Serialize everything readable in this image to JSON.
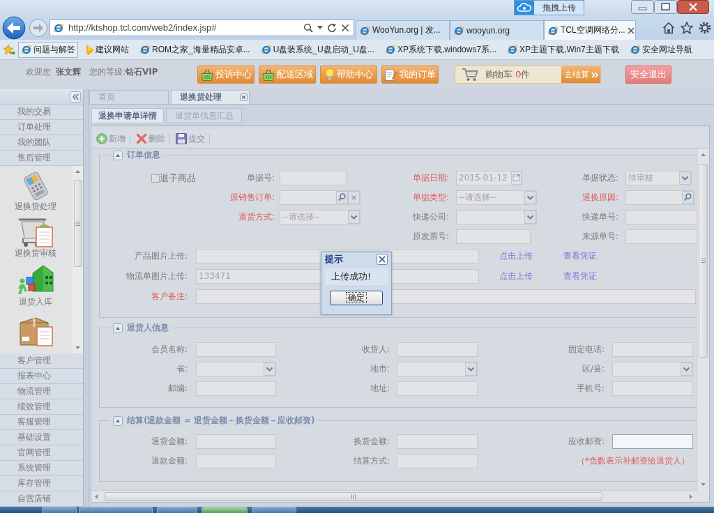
{
  "browser": {
    "upload_button": "拖拽上传",
    "address": "http://ktshop.tcl.com/web2/index.jsp#",
    "tabs": [
      {
        "label": "WooYun.org | 发...",
        "selected": false
      },
      {
        "label": "wooyun.org",
        "selected": false
      },
      {
        "label": "TCL空调网络分...",
        "selected": true
      }
    ],
    "favorites": [
      {
        "label": "问题与解答",
        "kind": "web",
        "hovered": true
      },
      {
        "label": "建议网站",
        "kind": "suggest",
        "hovered": false
      },
      {
        "label": "ROM之家_海量精品安卓...",
        "kind": "web",
        "hovered": false
      },
      {
        "label": "U盘装系统_U盘启动_U盘...",
        "kind": "web",
        "hovered": false
      },
      {
        "label": "XP系统下载,windows7系...",
        "kind": "web",
        "hovered": false
      },
      {
        "label": "XP主题下载,Win7主题下载",
        "kind": "web",
        "hovered": false
      },
      {
        "label": "安全网址导航",
        "kind": "web",
        "hovered": false
      }
    ]
  },
  "header": {
    "welcome": "欢迎您",
    "user": "张文辉",
    "level_label": "您的等级:",
    "level": "钻石VIP",
    "buttons": [
      {
        "label": "投诉中心",
        "kind": "basket"
      },
      {
        "label": "配送区域",
        "kind": "basket"
      },
      {
        "label": "帮助中心",
        "kind": "bulb"
      },
      {
        "label": "我的订单",
        "kind": "notes"
      }
    ],
    "cart": {
      "label": "购物车",
      "count": "0",
      "unit": "件",
      "checkout": "去结算"
    },
    "logout": "安全退出"
  },
  "sidebar": {
    "groups": [
      {
        "label": "我的交易"
      },
      {
        "label": "订单处理"
      },
      {
        "label": "我的团队"
      },
      {
        "label": "售后管理",
        "modules": [
          {
            "label": "退换货处理",
            "kind": "terminal"
          },
          {
            "label": "退换货审核",
            "kind": "cart"
          },
          {
            "label": "退货入库",
            "kind": "blocks"
          },
          {
            "kind": "box"
          }
        ]
      },
      {
        "label": "客户管理"
      },
      {
        "label": "报表中心"
      },
      {
        "label": "物流管理"
      },
      {
        "label": "绩效管理"
      },
      {
        "label": "客服管理"
      },
      {
        "label": "基础设置"
      },
      {
        "label": "官网管理"
      },
      {
        "label": "系统管理"
      },
      {
        "label": "库存管理"
      },
      {
        "label": "自营店铺"
      }
    ]
  },
  "tabs": [
    {
      "label": "首页",
      "selected": false,
      "closable": false
    },
    {
      "label": "退换货处理",
      "selected": true,
      "closable": true
    }
  ],
  "subtabs": [
    {
      "label": "退换申请单详情",
      "selected": true
    },
    {
      "label": "退货单信息汇总",
      "selected": false
    }
  ],
  "toolbar": [
    {
      "label": "新增",
      "kind": "add"
    },
    {
      "label": "删除",
      "kind": "delete"
    },
    {
      "label": "提交",
      "kind": "submit"
    }
  ],
  "order": {
    "title": "订单信息",
    "expanded": true,
    "return_child": {
      "label": "退子商品",
      "checked": false
    },
    "columns": [
      [
        {
          "label": "单据号:",
          "kind": "text",
          "required": false
        },
        {
          "label": "原销售订单:",
          "kind": "lookup",
          "required": true
        },
        {
          "label": "退货方式:",
          "kind": "select",
          "required": true,
          "value": "--请选择--"
        }
      ],
      [
        {
          "label": "单据日期:",
          "kind": "date",
          "required": true,
          "value": "2015-01-12"
        },
        {
          "label": "单据类型:",
          "kind": "select",
          "required": true,
          "value": "--请选择--"
        },
        {
          "label": "快递公司:",
          "kind": "select",
          "required": false
        },
        {
          "label": "原发票号:",
          "kind": "text",
          "required": false
        }
      ],
      [
        {
          "label": "单据状态:",
          "kind": "select",
          "required": false,
          "value": "待审核"
        },
        {
          "label": "退换原因:",
          "kind": "search",
          "required": true
        },
        {
          "label": "快递单号:",
          "kind": "text",
          "required": false
        },
        {
          "label": "来源单号:",
          "kind": "text",
          "required": false
        }
      ]
    ],
    "uploads": [
      {
        "label": "产品图片上传:",
        "upload": "点击上传",
        "view": "查看凭证"
      },
      {
        "label": "物流单图片上传:",
        "value": "133471",
        "upload": "点击上传",
        "view": "查看凭证"
      }
    ],
    "remark": {
      "label": "客户备注:",
      "required": true
    }
  },
  "returner": {
    "title": "退货人信息",
    "expanded": true,
    "fields": [
      {
        "label": "会员名称:",
        "kind": "text"
      },
      {
        "label": "收货人:",
        "kind": "text"
      },
      {
        "label": "固定电话:",
        "kind": "text"
      },
      {
        "label": "省:",
        "kind": "select"
      },
      {
        "label": "地市:",
        "kind": "select"
      },
      {
        "label": "区/县:",
        "kind": "select"
      },
      {
        "label": "邮编:",
        "kind": "text"
      },
      {
        "label": "地址:",
        "kind": "text"
      },
      {
        "label": "手机号:",
        "kind": "text"
      }
    ]
  },
  "settlement": {
    "title": "结算(退款金额 = 退货金额－换货金额－应收邮资)",
    "expanded": true,
    "fields": [
      {
        "label": "退货金额:",
        "kind": "text",
        "editable": false
      },
      {
        "label": "换货金额:",
        "kind": "text",
        "editable": false
      },
      {
        "label": "应收邮资:",
        "kind": "text",
        "editable": true
      },
      {
        "label": "退款金额:",
        "kind": "text",
        "editable": false
      },
      {
        "label": "结算方式:",
        "kind": "text",
        "editable": false
      },
      {
        "kind": "note",
        "text": "（*负数表示补邮资给退货人）"
      }
    ]
  },
  "dialog": {
    "title": "提示",
    "message": "上传成功!",
    "button": "确定"
  }
}
